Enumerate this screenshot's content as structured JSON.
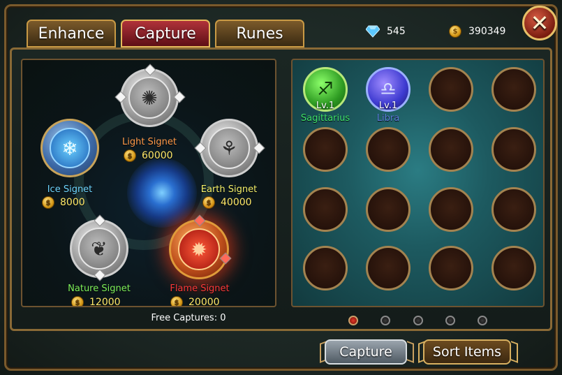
{
  "tabs": [
    {
      "label": "Enhance",
      "active": false
    },
    {
      "label": "Capture",
      "active": true
    },
    {
      "label": "Runes",
      "active": false
    }
  ],
  "resources": {
    "diamonds": "545",
    "gold": "390349"
  },
  "close_symbol": "✕",
  "signets": [
    {
      "id": "light",
      "name": "Light Signet",
      "cost": "60000",
      "name_color": "#ff9a4a",
      "icon": "sun-emblem-icon"
    },
    {
      "id": "ice",
      "name": "Ice Signet",
      "cost": "8000",
      "name_color": "#6fd6ff",
      "icon": "snowflake-emblem-icon"
    },
    {
      "id": "earth",
      "name": "Earth Signet",
      "cost": "40000",
      "name_color": "#f4f06a",
      "icon": "earth-emblem-icon"
    },
    {
      "id": "nature",
      "name": "Nature Signet",
      "cost": "12000",
      "name_color": "#7ef05a",
      "icon": "leaf-emblem-icon"
    },
    {
      "id": "flame",
      "name": "Flame Signet",
      "cost": "20000",
      "name_color": "#ff3a3a",
      "icon": "flame-emblem-icon"
    }
  ],
  "items": [
    {
      "level": "Lv.1",
      "name": "Sagittarius",
      "name_color": "#3ee06a",
      "icon": "sagittarius-sign-icon"
    },
    {
      "level": "Lv.1",
      "name": "Libra",
      "name_color": "#5a7ad8",
      "icon": "libra-sign-icon"
    }
  ],
  "free_captures": "Free Captures: 0",
  "pagination": {
    "pages": 5,
    "current": 1
  },
  "buttons": {
    "capture": "Capture",
    "sort": "Sort Items"
  }
}
